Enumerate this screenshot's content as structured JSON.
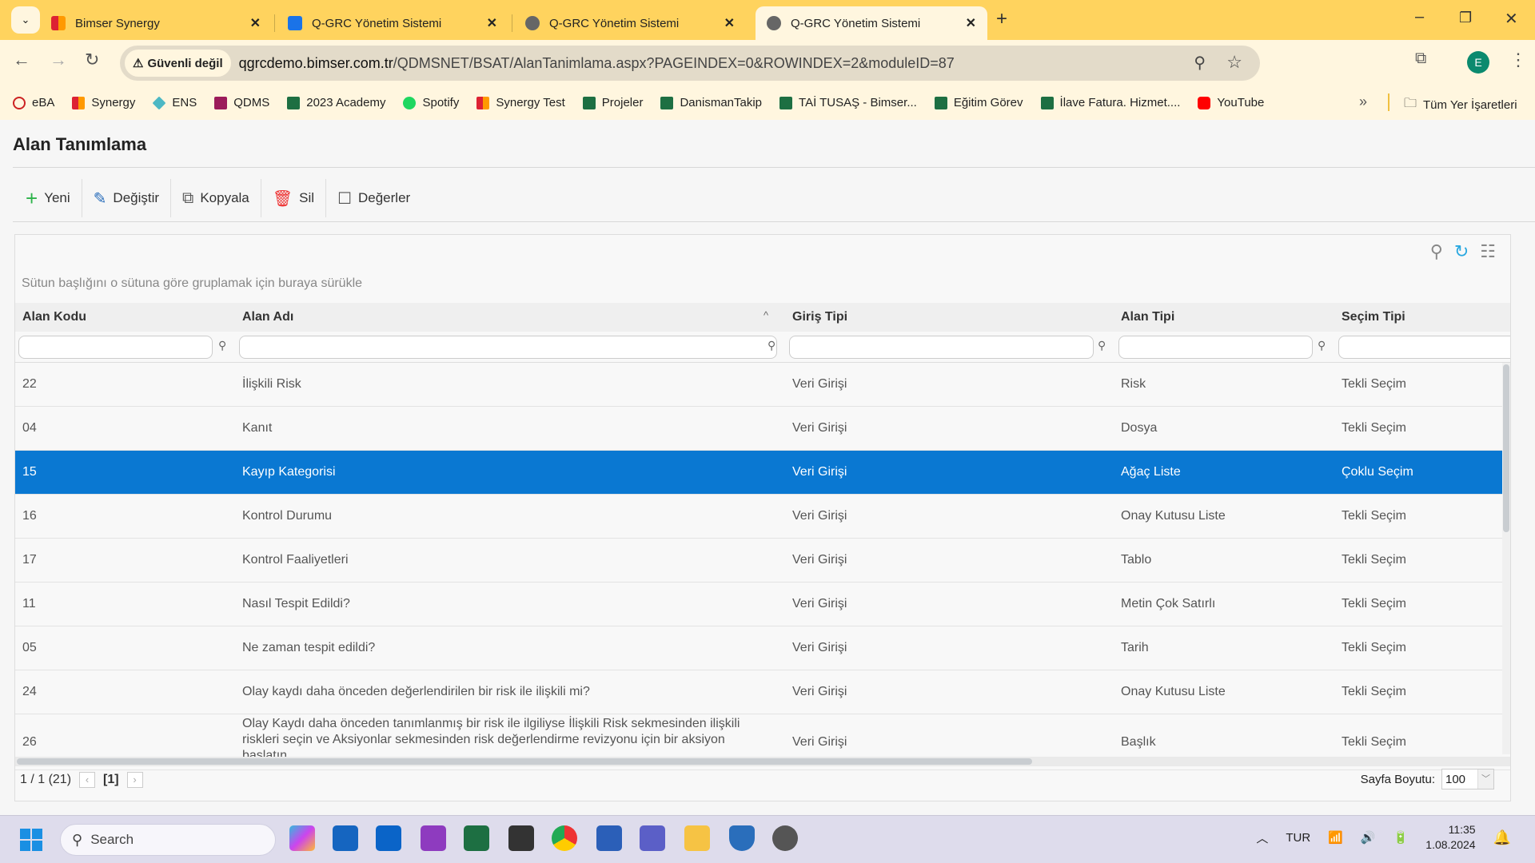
{
  "browser": {
    "tabs": [
      {
        "title": "Bimser Synergy",
        "active": false
      },
      {
        "title": "Q-GRC Yönetim Sistemi",
        "active": false
      },
      {
        "title": "Q-GRC Yönetim Sistemi",
        "active": false
      },
      {
        "title": "Q-GRC Yönetim Sistemi",
        "active": true
      }
    ],
    "security_label": "Güvenli değil",
    "url_host": "qgrcdemo.bimser.com.tr",
    "url_path": "/QDMSNET/BSAT/AlanTanimlama.aspx?PAGEINDEX=0&ROWINDEX=2&moduleID=87",
    "profile_initial": "E",
    "bookmarks": [
      "eBA",
      "Synergy",
      "ENS",
      "QDMS",
      "2023 Academy",
      "Spotify",
      "Synergy Test",
      "Projeler",
      "DanismanTakip",
      "TAİ TUSAŞ - Bimser...",
      "Eğitim Görev",
      "İlave Fatura. Hizmet....",
      "YouTube"
    ],
    "bookmarks_overflow": "»",
    "all_bookmarks": "Tüm Yer İşaretleri"
  },
  "page": {
    "title": "Alan Tanımlama",
    "toolbar": {
      "new": "Yeni",
      "edit": "Değiştir",
      "copy": "Kopyala",
      "delete": "Sil",
      "values": "Değerler"
    },
    "group_hint": "Sütun başlığını o sütuna göre gruplamak için buraya sürükle",
    "columns": [
      "Alan Kodu",
      "Alan Adı",
      "Giriş Tipi",
      "Alan Tipi",
      "Seçim Tipi"
    ],
    "sorted_column": "Alan Adı",
    "rows": [
      [
        "22",
        "İlişkili Risk",
        "Veri Girişi",
        "Risk",
        "Tekli Seçim"
      ],
      [
        "04",
        "Kanıt",
        "Veri Girişi",
        "Dosya",
        "Tekli Seçim"
      ],
      [
        "15",
        "Kayıp Kategorisi",
        "Veri Girişi",
        "Ağaç Liste",
        "Çoklu Seçim"
      ],
      [
        "16",
        "Kontrol Durumu",
        "Veri Girişi",
        "Onay Kutusu Liste",
        "Tekli Seçim"
      ],
      [
        "17",
        "Kontrol Faaliyetleri",
        "Veri Girişi",
        "Tablo",
        "Tekli Seçim"
      ],
      [
        "11",
        "Nasıl Tespit Edildi?",
        "Veri Girişi",
        "Metin Çok Satırlı",
        "Tekli Seçim"
      ],
      [
        "05",
        "Ne zaman tespit edildi?",
        "Veri Girişi",
        "Tarih",
        "Tekli Seçim"
      ],
      [
        "24",
        "Olay kaydı daha önceden değerlendirilen bir risk ile ilişkili mi?",
        "Veri Girişi",
        "Onay Kutusu Liste",
        "Tekli Seçim"
      ],
      [
        "26",
        "Olay Kaydı daha önceden tanımlanmış bir risk ile ilgiliyse İlişkili Risk sekmesinden ilişkili riskleri seçin ve Aksiyonlar sekmesinden risk değerlendirme revizyonu için bir aksiyon başlatın",
        "Veri Girişi",
        "Başlık",
        "Tekli Seçim"
      ]
    ],
    "selected_row_index": 2,
    "pager": {
      "summary": "1 / 1 (21)",
      "current": "[1]",
      "prev": "‹",
      "next": "›"
    },
    "page_size_label": "Sayfa Boyutu:",
    "page_size": "100",
    "selection_color": "#0a78d2"
  },
  "taskbar": {
    "search_placeholder": "Search",
    "language": "TUR",
    "time": "11:35",
    "date": "1.08.2024"
  }
}
